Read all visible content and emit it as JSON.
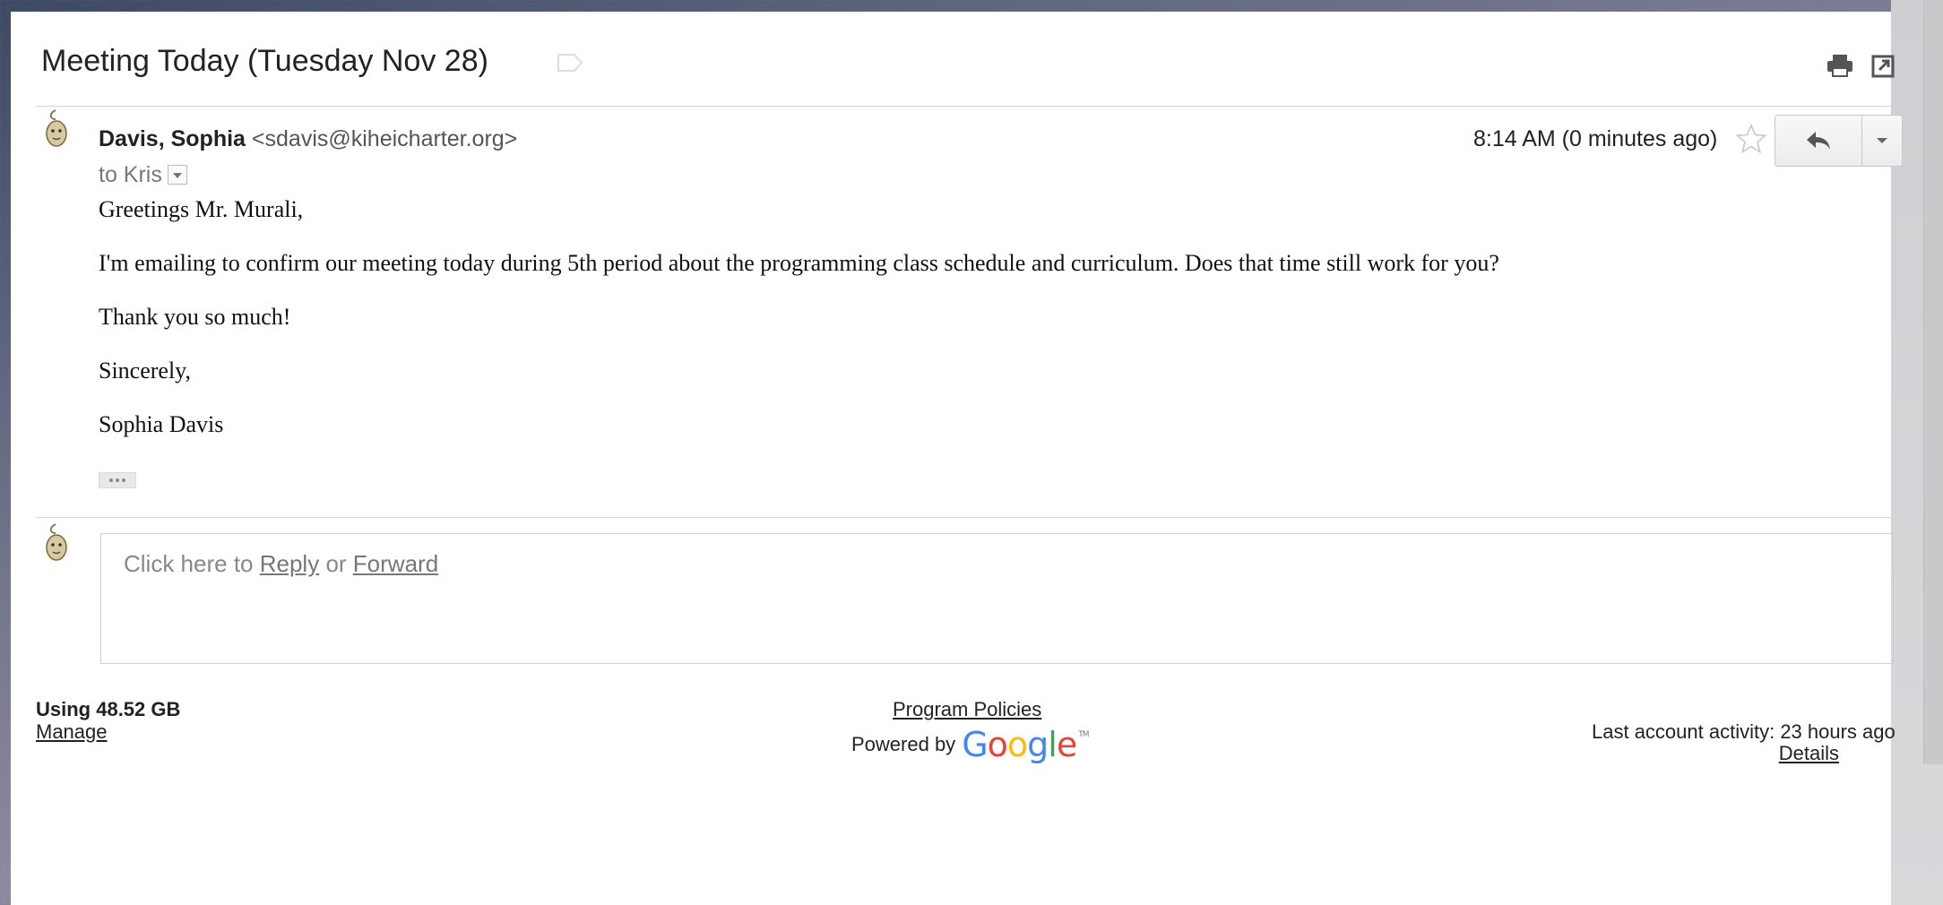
{
  "message": {
    "subject": "Meeting Today (Tuesday Nov 28)",
    "sender_name": "Davis, Sophia",
    "sender_email": "<sdavis@kiheicharter.org>",
    "recipient_line": "to Kris",
    "timestamp": "8:14 AM (0 minutes ago)",
    "body": [
      "Greetings Mr. Murali,",
      "I'm emailing to confirm our meeting today during 5th period about the programming class schedule and curriculum. Does that time still work for you?",
      "Thank you so much!",
      "Sincerely,",
      "Sophia Davis"
    ]
  },
  "reply": {
    "prefix": "Click here to ",
    "reply_link": "Reply",
    "middle": " or ",
    "forward_link": "Forward"
  },
  "footer": {
    "storage": "Using 48.52 GB",
    "manage": "Manage",
    "policies": "Program Policies",
    "powered_by": "Powered by",
    "google_letters": [
      "G",
      "o",
      "o",
      "g",
      "l",
      "e"
    ],
    "google_tm": "TM",
    "activity": "Last account activity: 23 hours ago",
    "details": "Details"
  },
  "icons": {
    "label": "label-icon",
    "print": "print-icon",
    "new_window": "new-window-icon",
    "star": "star-icon",
    "reply": "reply-arrow-icon",
    "more": "chevron-down-icon",
    "avatar": "avatar"
  },
  "colors": {
    "google": [
      "#4285F4",
      "#EA4335",
      "#FBBC05",
      "#4285F4",
      "#34A853",
      "#EA4335"
    ]
  }
}
